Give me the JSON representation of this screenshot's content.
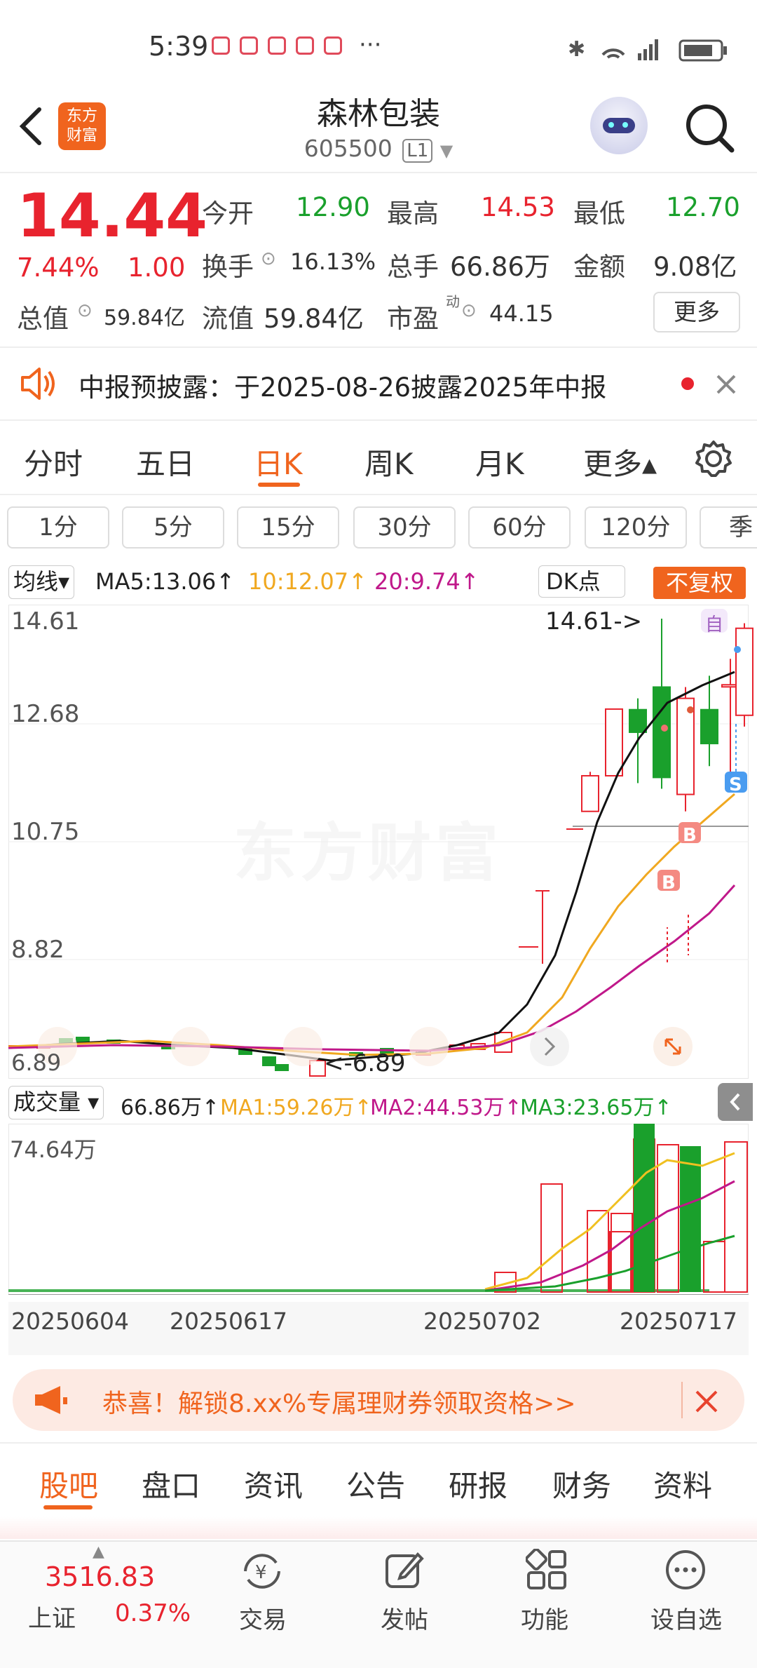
{
  "status": {
    "time": "5:39",
    "dots": "···"
  },
  "header": {
    "name": "森林包装",
    "code": "605500",
    "level": "L1",
    "logo_line1": "东方",
    "logo_line2": "财富"
  },
  "quote": {
    "price": "14.44",
    "change_pct": "7.44%",
    "change": "1.00",
    "open_label": "今开",
    "open": "12.90",
    "high_label": "最高",
    "high": "14.53",
    "low_label": "最低",
    "low": "12.70",
    "turnover_label": "换手",
    "turnover": "16.13%",
    "volume_label": "总手",
    "volume": "66.86万",
    "amount_label": "金额",
    "amount": "9.08亿",
    "mcap_label": "总值",
    "mcap": "59.84亿",
    "float_label": "流值",
    "float": "59.84亿",
    "pe_label": "市盈",
    "pe_super": "动",
    "pe": "44.15",
    "more": "更多"
  },
  "notice": {
    "text": "中报预披露：于2025-08-26披露2025年中报"
  },
  "chart_tabs": [
    "分时",
    "五日",
    "日K",
    "周K",
    "月K",
    "更多▴"
  ],
  "period_buttons": [
    "1分",
    "5分",
    "15分",
    "30分",
    "60分",
    "120分",
    "季"
  ],
  "ma_bar": {
    "selector": "均线▾",
    "ma5": "MA5:13.06↑",
    "ma10": "10:12.07↑",
    "ma20": "20:9.74↑",
    "dk": "DK点",
    "fq": "不复权"
  },
  "price_axis": [
    "14.61",
    "12.68",
    "10.75",
    "8.82",
    "6.89"
  ],
  "annotations": {
    "max": "14.61->",
    "min": "<-6.89",
    "watermark": "东方财富",
    "self": "自",
    "b1": "B",
    "b2": "B",
    "s1": "S"
  },
  "vol_bar": {
    "selector": "成交量 ▾",
    "vol": "66.86万↑",
    "ma1": "MA1:59.26万↑",
    "ma2": "MA2:44.53万↑",
    "ma3": "MA3:23.65万↑",
    "axis_max": "74.64万"
  },
  "dates": [
    "20250604",
    "20250617",
    "20250702",
    "20250717"
  ],
  "chart_data": {
    "type": "candlestick",
    "y_range": [
      6.89,
      14.61
    ],
    "candles_recent": [
      {
        "o": 10.75,
        "h": 10.75,
        "l": 10.75,
        "c": 10.75
      },
      {
        "o": 11.2,
        "h": 11.9,
        "l": 11.2,
        "c": 11.83
      },
      {
        "o": 11.83,
        "h": 13.01,
        "l": 11.83,
        "c": 13.01
      },
      {
        "o": 13.0,
        "h": 13.2,
        "l": 11.7,
        "c": 12.6
      },
      {
        "o": 13.4,
        "h": 14.61,
        "l": 11.6,
        "c": 11.8
      },
      {
        "o": 11.5,
        "h": 13.4,
        "l": 11.2,
        "c": 13.2
      },
      {
        "o": 13.0,
        "h": 13.6,
        "l": 12.0,
        "c": 12.4
      },
      {
        "o": 13.44,
        "h": 13.9,
        "l": 11.8,
        "c": 13.44
      },
      {
        "o": 12.9,
        "h": 14.53,
        "l": 12.7,
        "c": 14.44
      }
    ]
  },
  "ad": {
    "text": "恭喜！解锁8.xx%专属理财券领取资格>>"
  },
  "bottom_tabs": [
    "股吧",
    "盘口",
    "资讯",
    "公告",
    "研报",
    "财务",
    "资料"
  ],
  "index": {
    "value": "3516.83",
    "name": "上证",
    "pct": "0.37%"
  },
  "dock": [
    "交易",
    "发帖",
    "功能",
    "设自选"
  ],
  "colors": {
    "up": "#e8232e",
    "down": "#1aa02c",
    "accent": "#f0641e"
  }
}
